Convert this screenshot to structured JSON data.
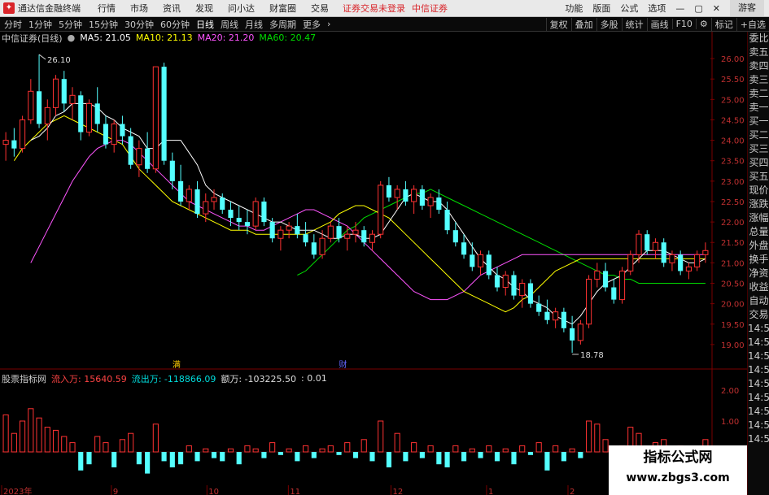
{
  "titlebar": {
    "app_title": "通达信金融终端",
    "menu": [
      "行情",
      "市场",
      "资讯",
      "发现",
      "问小达",
      "财富圈",
      "交易"
    ],
    "notice": "证券交易未登录",
    "broker": "中信证券",
    "right_items": [
      "功能",
      "版面",
      "公式",
      "选项"
    ],
    "guest": "游客"
  },
  "toolbar": {
    "periods": [
      "分时",
      "1分钟",
      "5分钟",
      "15分钟",
      "30分钟",
      "60分钟",
      "日线",
      "周线",
      "月线",
      "多周期",
      "更多"
    ],
    "active_period": "日线",
    "right_buttons": [
      "复权",
      "叠加",
      "多股",
      "统计",
      "画线",
      "F10",
      "标记",
      "+自选"
    ]
  },
  "legend": {
    "name": "中信证券(日线)",
    "ma5": "MA5: 21.05",
    "ma10": "MA10: 21.13",
    "ma20": "MA20: 21.20",
    "ma60": "MA60: 20.47",
    "colors": {
      "ma5": "#ffffff",
      "ma10": "#ffff00",
      "ma20": "#ff55ff",
      "ma60": "#00dd00"
    }
  },
  "annotations": {
    "high": "26.10",
    "low": "18.78",
    "event_a": "满",
    "event_b": "财"
  },
  "vol_legend": {
    "name": "股票指标网",
    "inflow": "流入万: 15640.59",
    "outflow": "流出万: -118866.09",
    "net": "额万: -103225.50",
    "extra": ": 0.01"
  },
  "side_panel": [
    "委比",
    "卖五",
    "卖四",
    "卖三",
    "卖二",
    "卖一",
    "买一",
    "买二",
    "买三",
    "买四",
    "买五",
    "现价",
    "涨跌",
    "涨幅",
    "总量",
    "外盘",
    "换手",
    "净资",
    "收益",
    "自动",
    "交易",
    "14:50",
    "14:50",
    "14:50",
    "14:50",
    "14:50",
    "14:50",
    "14:50",
    "14:50",
    "14:50"
  ],
  "price_axis": [
    "26.00",
    "25.50",
    "25.00",
    "24.50",
    "24.00",
    "23.50",
    "23.00",
    "22.50",
    "22.00",
    "21.50",
    "21.00",
    "20.50",
    "20.00",
    "19.50",
    "19.00"
  ],
  "vol_axis": [
    "2.00",
    "1.00"
  ],
  "date_axis": [
    "2023年",
    "9",
    "10",
    "11",
    "12",
    "1",
    "2"
  ],
  "watermark": {
    "line1": "指标公式网",
    "line2": "www.zbgs3.com"
  },
  "chart_data": {
    "type": "candlestick",
    "price_range": [
      18.6,
      26.3
    ],
    "candles": [
      [
        23.9,
        24.2,
        23.5,
        24.0
      ],
      [
        24.0,
        24.3,
        23.6,
        23.8
      ],
      [
        23.8,
        24.6,
        23.7,
        24.5
      ],
      [
        24.5,
        25.5,
        24.4,
        25.2
      ],
      [
        25.2,
        26.1,
        24.3,
        24.4
      ],
      [
        24.4,
        25.0,
        24.0,
        24.8
      ],
      [
        24.8,
        25.6,
        24.6,
        25.5
      ],
      [
        25.5,
        25.7,
        24.7,
        24.9
      ],
      [
        24.9,
        25.3,
        24.5,
        25.1
      ],
      [
        25.1,
        25.2,
        24.0,
        24.2
      ],
      [
        24.2,
        25.0,
        24.1,
        24.9
      ],
      [
        24.9,
        25.3,
        24.2,
        24.4
      ],
      [
        24.4,
        24.6,
        23.8,
        23.9
      ],
      [
        23.9,
        24.5,
        23.7,
        24.4
      ],
      [
        24.4,
        24.6,
        23.9,
        24.1
      ],
      [
        24.1,
        24.3,
        23.3,
        23.4
      ],
      [
        23.4,
        24.0,
        23.1,
        23.8
      ],
      [
        23.8,
        24.2,
        23.2,
        23.3
      ],
      [
        23.3,
        25.8,
        23.2,
        25.8
      ],
      [
        25.8,
        25.9,
        23.4,
        23.5
      ],
      [
        23.5,
        23.7,
        22.8,
        23.0
      ],
      [
        23.0,
        23.4,
        22.4,
        22.5
      ],
      [
        22.5,
        22.9,
        22.3,
        22.8
      ],
      [
        22.8,
        23.0,
        22.1,
        22.2
      ],
      [
        22.2,
        22.7,
        22.0,
        22.5
      ],
      [
        22.5,
        22.8,
        22.3,
        22.6
      ],
      [
        22.6,
        22.7,
        22.2,
        22.3
      ],
      [
        22.3,
        22.5,
        21.9,
        22.1
      ],
      [
        22.1,
        22.4,
        21.8,
        22.0
      ],
      [
        22.0,
        22.3,
        21.7,
        21.9
      ],
      [
        21.9,
        22.6,
        21.8,
        22.5
      ],
      [
        22.5,
        22.6,
        21.9,
        22.0
      ],
      [
        22.0,
        22.1,
        21.5,
        21.6
      ],
      [
        21.6,
        21.9,
        21.3,
        21.8
      ],
      [
        21.8,
        22.0,
        21.6,
        21.9
      ],
      [
        21.9,
        22.2,
        21.6,
        21.7
      ],
      [
        21.7,
        22.0,
        21.4,
        21.5
      ],
      [
        21.5,
        21.7,
        21.1,
        21.2
      ],
      [
        21.2,
        21.8,
        21.1,
        21.6
      ],
      [
        21.6,
        22.0,
        21.5,
        21.9
      ],
      [
        21.9,
        22.1,
        21.5,
        21.6
      ],
      [
        21.6,
        21.9,
        21.3,
        21.7
      ],
      [
        21.7,
        22.0,
        21.5,
        21.8
      ],
      [
        21.8,
        21.9,
        21.4,
        21.5
      ],
      [
        21.5,
        21.8,
        21.3,
        21.7
      ],
      [
        21.7,
        23.0,
        21.6,
        22.9
      ],
      [
        22.9,
        23.1,
        22.5,
        22.6
      ],
      [
        22.6,
        22.9,
        22.3,
        22.8
      ],
      [
        22.8,
        23.0,
        22.4,
        22.5
      ],
      [
        22.5,
        22.9,
        22.2,
        22.8
      ],
      [
        22.8,
        22.9,
        22.3,
        22.4
      ],
      [
        22.4,
        22.7,
        22.1,
        22.6
      ],
      [
        22.6,
        22.8,
        22.2,
        22.3
      ],
      [
        22.3,
        22.5,
        21.7,
        21.8
      ],
      [
        21.8,
        22.0,
        21.4,
        21.5
      ],
      [
        21.5,
        21.7,
        21.1,
        21.2
      ],
      [
        21.2,
        21.5,
        20.8,
        20.9
      ],
      [
        20.9,
        21.3,
        20.7,
        21.2
      ],
      [
        21.2,
        21.3,
        20.6,
        20.7
      ],
      [
        20.7,
        20.9,
        20.3,
        20.4
      ],
      [
        20.4,
        20.8,
        20.2,
        20.7
      ],
      [
        20.7,
        20.8,
        20.1,
        20.2
      ],
      [
        20.2,
        20.6,
        19.9,
        20.5
      ],
      [
        20.5,
        20.6,
        19.9,
        20.0
      ],
      [
        20.0,
        20.2,
        19.7,
        19.8
      ],
      [
        19.8,
        20.1,
        19.5,
        19.6
      ],
      [
        19.6,
        19.9,
        19.4,
        19.8
      ],
      [
        19.8,
        19.9,
        19.3,
        19.4
      ],
      [
        19.4,
        19.7,
        18.8,
        19.1
      ],
      [
        19.1,
        19.6,
        19.0,
        19.5
      ],
      [
        19.5,
        20.7,
        19.4,
        20.6
      ],
      [
        20.6,
        21.0,
        20.4,
        20.8
      ],
      [
        20.8,
        21.0,
        20.3,
        20.4
      ],
      [
        20.4,
        20.6,
        20.0,
        20.1
      ],
      [
        20.1,
        20.9,
        20.0,
        20.8
      ],
      [
        20.8,
        21.3,
        20.7,
        21.2
      ],
      [
        21.2,
        21.8,
        21.0,
        21.7
      ],
      [
        21.7,
        21.8,
        21.2,
        21.3
      ],
      [
        21.3,
        21.6,
        21.1,
        21.5
      ],
      [
        21.5,
        21.6,
        20.9,
        21.0
      ],
      [
        21.0,
        21.3,
        20.8,
        21.2
      ],
      [
        21.2,
        21.3,
        20.7,
        20.8
      ],
      [
        20.8,
        21.0,
        20.6,
        20.9
      ],
      [
        20.9,
        21.3,
        20.8,
        21.2
      ],
      [
        21.2,
        21.5,
        21.0,
        21.3
      ]
    ],
    "ma5": [
      24.0,
      24.1,
      24.3,
      24.6,
      24.7,
      24.9,
      24.9,
      24.9,
      24.8,
      24.6,
      24.5,
      24.3,
      24.2,
      24.1,
      23.8,
      23.8,
      24.0,
      24.0,
      24.0,
      23.7,
      23.4,
      22.9,
      22.7,
      22.6,
      22.5,
      22.4,
      22.3,
      22.2,
      22.1,
      22.0,
      22.0,
      21.9,
      21.8,
      21.8,
      21.8,
      21.7,
      21.6,
      21.6,
      21.7,
      21.7,
      21.6,
      21.6,
      21.7,
      22.0,
      22.3,
      22.6,
      22.7,
      22.6,
      22.5,
      22.5,
      22.3,
      22.0,
      21.7,
      21.4,
      21.1,
      20.9,
      20.7,
      20.6,
      20.4,
      20.3,
      20.1,
      20.0,
      19.9,
      19.7,
      19.6,
      19.5,
      19.7,
      20.0,
      20.3,
      20.5,
      20.6,
      20.7,
      20.9,
      21.1,
      21.3,
      21.3,
      21.3,
      21.2,
      21.1,
      21.0,
      21.0,
      21.1
    ],
    "ma10": [
      23.5,
      23.8,
      24.0,
      24.2,
      24.4,
      24.5,
      24.6,
      24.5,
      24.4,
      24.3,
      24.2,
      24.1,
      24.0,
      23.9,
      23.6,
      23.3,
      23.1,
      22.9,
      22.7,
      22.5,
      22.4,
      22.3,
      22.2,
      22.1,
      22.0,
      21.9,
      21.8,
      21.8,
      21.8,
      21.7,
      21.7,
      21.7,
      21.7,
      21.7,
      21.7,
      21.7,
      21.8,
      21.9,
      22.0,
      22.2,
      22.3,
      22.4,
      22.4,
      22.3,
      22.2,
      22.1,
      21.9,
      21.7,
      21.5,
      21.3,
      21.1,
      20.9,
      20.7,
      20.5,
      20.3,
      20.2,
      20.1,
      20.0,
      19.9,
      19.8,
      19.9,
      20.1,
      20.2,
      20.4,
      20.6,
      20.8,
      20.9,
      21.0,
      21.1,
      21.1,
      21.1,
      21.1,
      21.1,
      21.1,
      21.1,
      21.1,
      21.1,
      21.1,
      21.1,
      21.1,
      21.1,
      21.1,
      21.1,
      21.1
    ],
    "ma20": [
      21.0,
      21.4,
      21.8,
      22.2,
      22.6,
      23.0,
      23.3,
      23.6,
      23.8,
      23.9,
      24.0,
      24.0,
      23.9,
      23.7,
      23.5,
      23.3,
      23.1,
      22.9,
      22.7,
      22.5,
      22.4,
      22.3,
      22.2,
      22.1,
      22.0,
      21.9,
      21.9,
      21.8,
      21.8,
      21.9,
      22.0,
      22.1,
      22.2,
      22.3,
      22.3,
      22.2,
      22.1,
      22.0,
      21.9,
      21.7,
      21.5,
      21.3,
      21.1,
      20.9,
      20.7,
      20.5,
      20.3,
      20.2,
      20.1,
      20.1,
      20.1,
      20.2,
      20.3,
      20.5,
      20.7,
      20.8,
      20.9,
      21.0,
      21.1,
      21.2,
      21.2,
      21.2,
      21.2,
      21.2,
      21.2,
      21.2,
      21.2,
      21.2,
      21.2,
      21.2,
      21.2,
      21.2,
      21.2,
      21.2,
      21.2,
      21.2,
      21.2,
      21.2,
      21.2,
      21.2,
      21.2,
      21.2
    ],
    "ma60": [
      20.7,
      20.8,
      21.0,
      21.2,
      21.4,
      21.6,
      21.8,
      21.9,
      22.1,
      22.2,
      22.3,
      22.4,
      22.5,
      22.6,
      22.7,
      22.7,
      22.8,
      22.7,
      22.6,
      22.5,
      22.4,
      22.3,
      22.2,
      22.1,
      22.0,
      21.9,
      21.8,
      21.7,
      21.6,
      21.5,
      21.4,
      21.3,
      21.2,
      21.1,
      21.0,
      20.9,
      20.8,
      20.7,
      20.7,
      20.6,
      20.6,
      20.5,
      20.5,
      20.5,
      20.5,
      20.5,
      20.5,
      20.5,
      20.5,
      20.5
    ],
    "volume": [
      1.2,
      0.6,
      1.0,
      1.4,
      1.1,
      0.8,
      0.7,
      0.5,
      0.3,
      -0.6,
      -0.4,
      0.5,
      0.3,
      -0.5,
      0.4,
      0.6,
      -0.4,
      -0.7,
      0.9,
      -0.3,
      -0.5,
      -0.4,
      0.2,
      -0.3,
      0.1,
      -0.2,
      -0.3,
      0.1,
      -0.4,
      0.2,
      0.1,
      -0.2,
      0.3,
      -0.1,
      0.1,
      -0.3,
      0.2,
      -0.2,
      0.1,
      0.2,
      -0.1,
      0.3,
      -0.2,
      0.4,
      -0.3,
      1.0,
      -0.5,
      0.6,
      -0.3,
      0.3,
      -0.2,
      0.2,
      -0.4,
      -0.5,
      0.2,
      -0.3,
      0.1,
      -0.2,
      0.2,
      -0.3,
      0.1,
      -0.4,
      0.2,
      -0.1,
      0.3,
      -0.6,
      0.2,
      -0.3,
      0.1,
      -0.2,
      1.0,
      0.9,
      0.4,
      -0.3,
      0.2,
      0.8,
      0.6,
      -0.3,
      0.3,
      0.4,
      -0.5,
      0.2,
      -0.3,
      0.1,
      0.4,
      -0.2
    ]
  }
}
